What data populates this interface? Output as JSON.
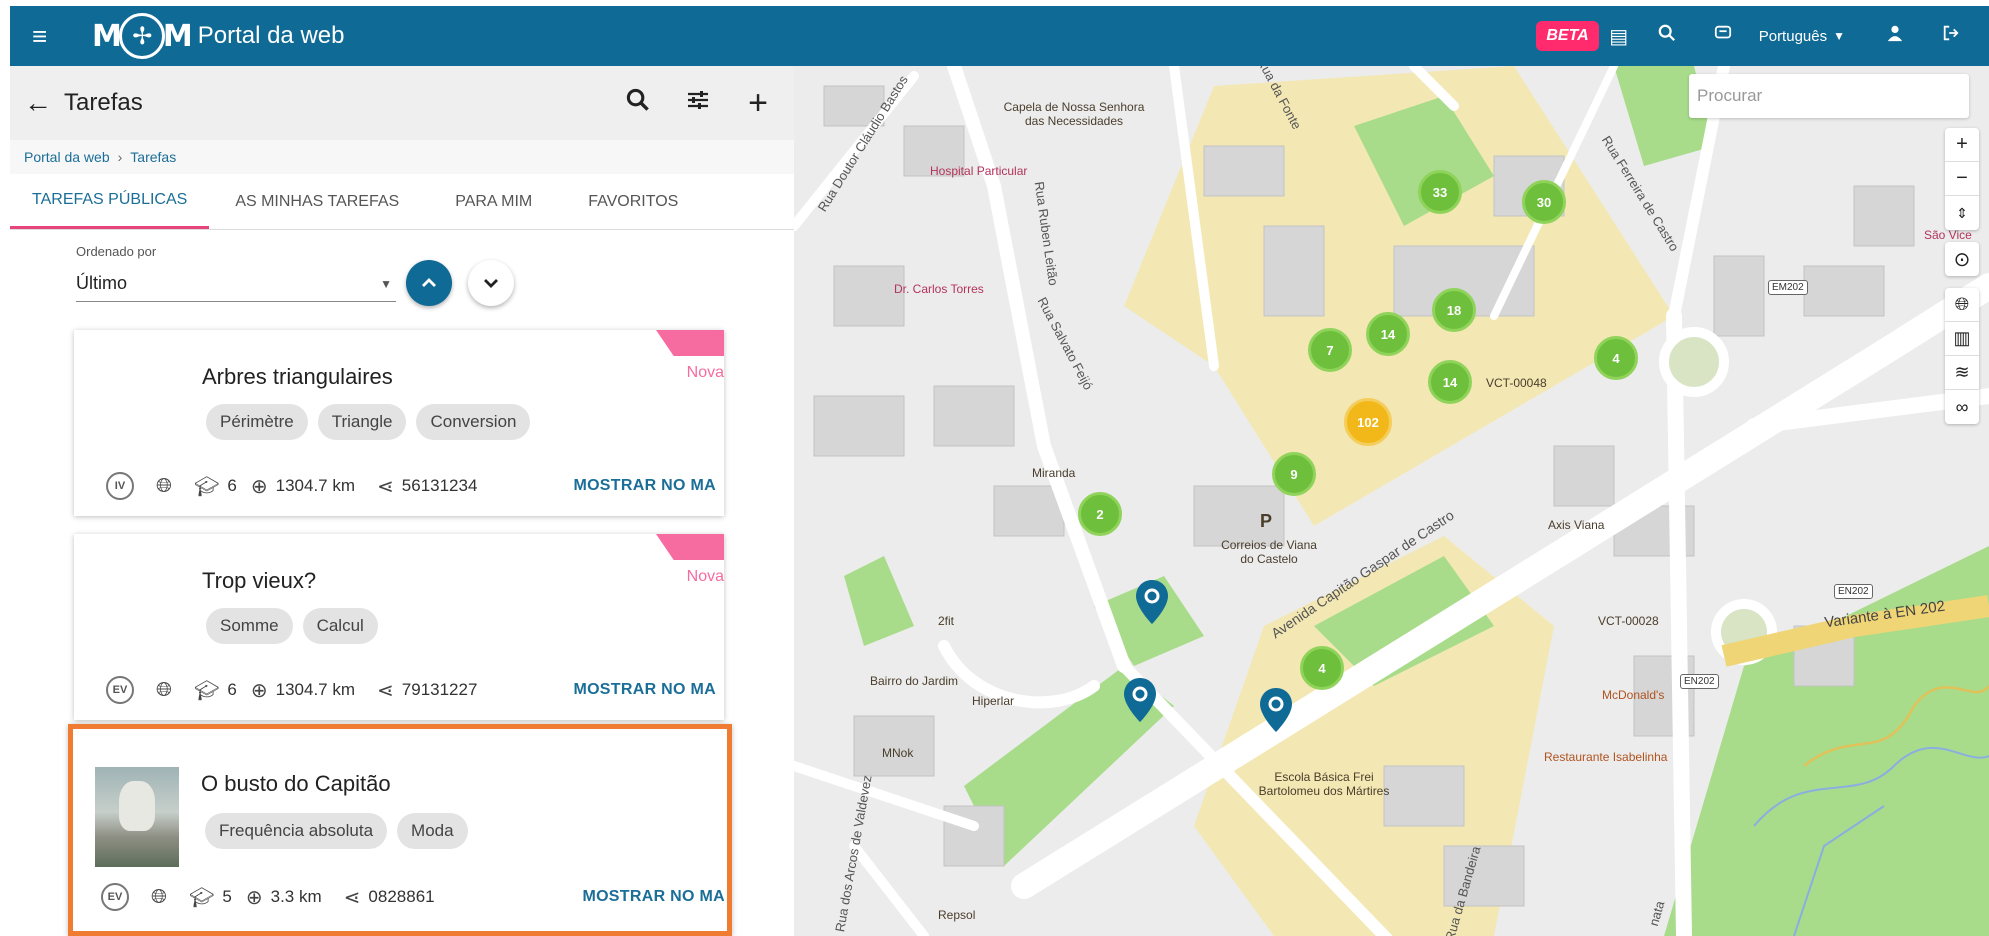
{
  "header": {
    "app_title": "Portal da web",
    "logo_left": "M",
    "logo_right": "M",
    "beta_label": "BETA",
    "language": "Português",
    "icons": [
      "menu-icon",
      "document-icon",
      "search-icon",
      "chat-icon",
      "user-icon",
      "logout-icon"
    ]
  },
  "panel": {
    "title": "Tarefas",
    "breadcrumb": [
      "Portal da web",
      "Tarefas"
    ],
    "tabs": [
      "TAREFAS PÚBLICAS",
      "AS MINHAS TAREFAS",
      "PARA MIM",
      "FAVORITOS"
    ],
    "active_tab": 0,
    "sort": {
      "label": "Ordenado por",
      "value": "Último"
    }
  },
  "cards": [
    {
      "title": "Arbres triangulaires",
      "ribbon": "Nova",
      "chips": [
        "Périmètre",
        "Triangle",
        "Conversion"
      ],
      "level": "IV",
      "grade": "6",
      "distance": "1304.7 km",
      "code": "56131234",
      "action": "MOSTRAR NO MA"
    },
    {
      "title": "Trop vieux?",
      "ribbon": "Nova",
      "chips": [
        "Somme",
        "Calcul"
      ],
      "level": "EV",
      "grade": "6",
      "distance": "1304.7 km",
      "code": "79131227",
      "action": "MOSTRAR NO MA"
    },
    {
      "title": "O busto do Capitão",
      "ribbon": "",
      "chips": [
        "Frequência absoluta",
        "Moda"
      ],
      "level": "EV",
      "grade": "5",
      "distance": "3.3 km",
      "code": "0828861",
      "action": "MOSTRAR NO MA"
    }
  ],
  "map": {
    "search_placeholder": "Procurar",
    "clusters": [
      "33",
      "30",
      "18",
      "14",
      "7",
      "14",
      "4",
      "102",
      "9",
      "2",
      "4"
    ],
    "labels": {
      "chapel": "Capela de Nossa Senhora das Necessidades",
      "hospital": "Hospital Particular",
      "doctor": "Dr. Carlos Torres",
      "miranda": "Miranda",
      "correios": "Correios de Viana do Castelo",
      "parking": "P",
      "vct48": "VCT-00048",
      "vct28": "VCT-00028",
      "axis": "Axis Viana",
      "fit": "2fit",
      "bairro": "Bairro do Jardim",
      "hiperlar": "Hiperlar",
      "mnok": "MNok",
      "repsol": "Repsol",
      "escola": "Escola Básica Frei Bartolomeu dos Mártires",
      "mcdonalds": "McDonald's",
      "restaurante": "Restaurante Isabelinha",
      "sao": "São Vice"
    },
    "streets": {
      "claudio": "Rua Doutor Cláudio Bastos",
      "ruben": "Rua Ruben Leitão",
      "salvato": "Rua Salvato Feijó",
      "fonte": "Rua da Fonte",
      "ferreira": "Rua Ferreira de Castro",
      "avenida": "Avenida Capitão Gaspar de Castro",
      "variante": "Variante à EN 202",
      "arcos": "Rua dos Arcos de Valdevez",
      "bandeira": "Rua da Bandeira",
      "nata": "nata"
    },
    "shields": [
      "EM202",
      "EN202",
      "EN202"
    ],
    "controls": [
      "zoom-in",
      "zoom-out",
      "compass",
      "locate",
      "globe",
      "building",
      "layers",
      "link"
    ]
  }
}
